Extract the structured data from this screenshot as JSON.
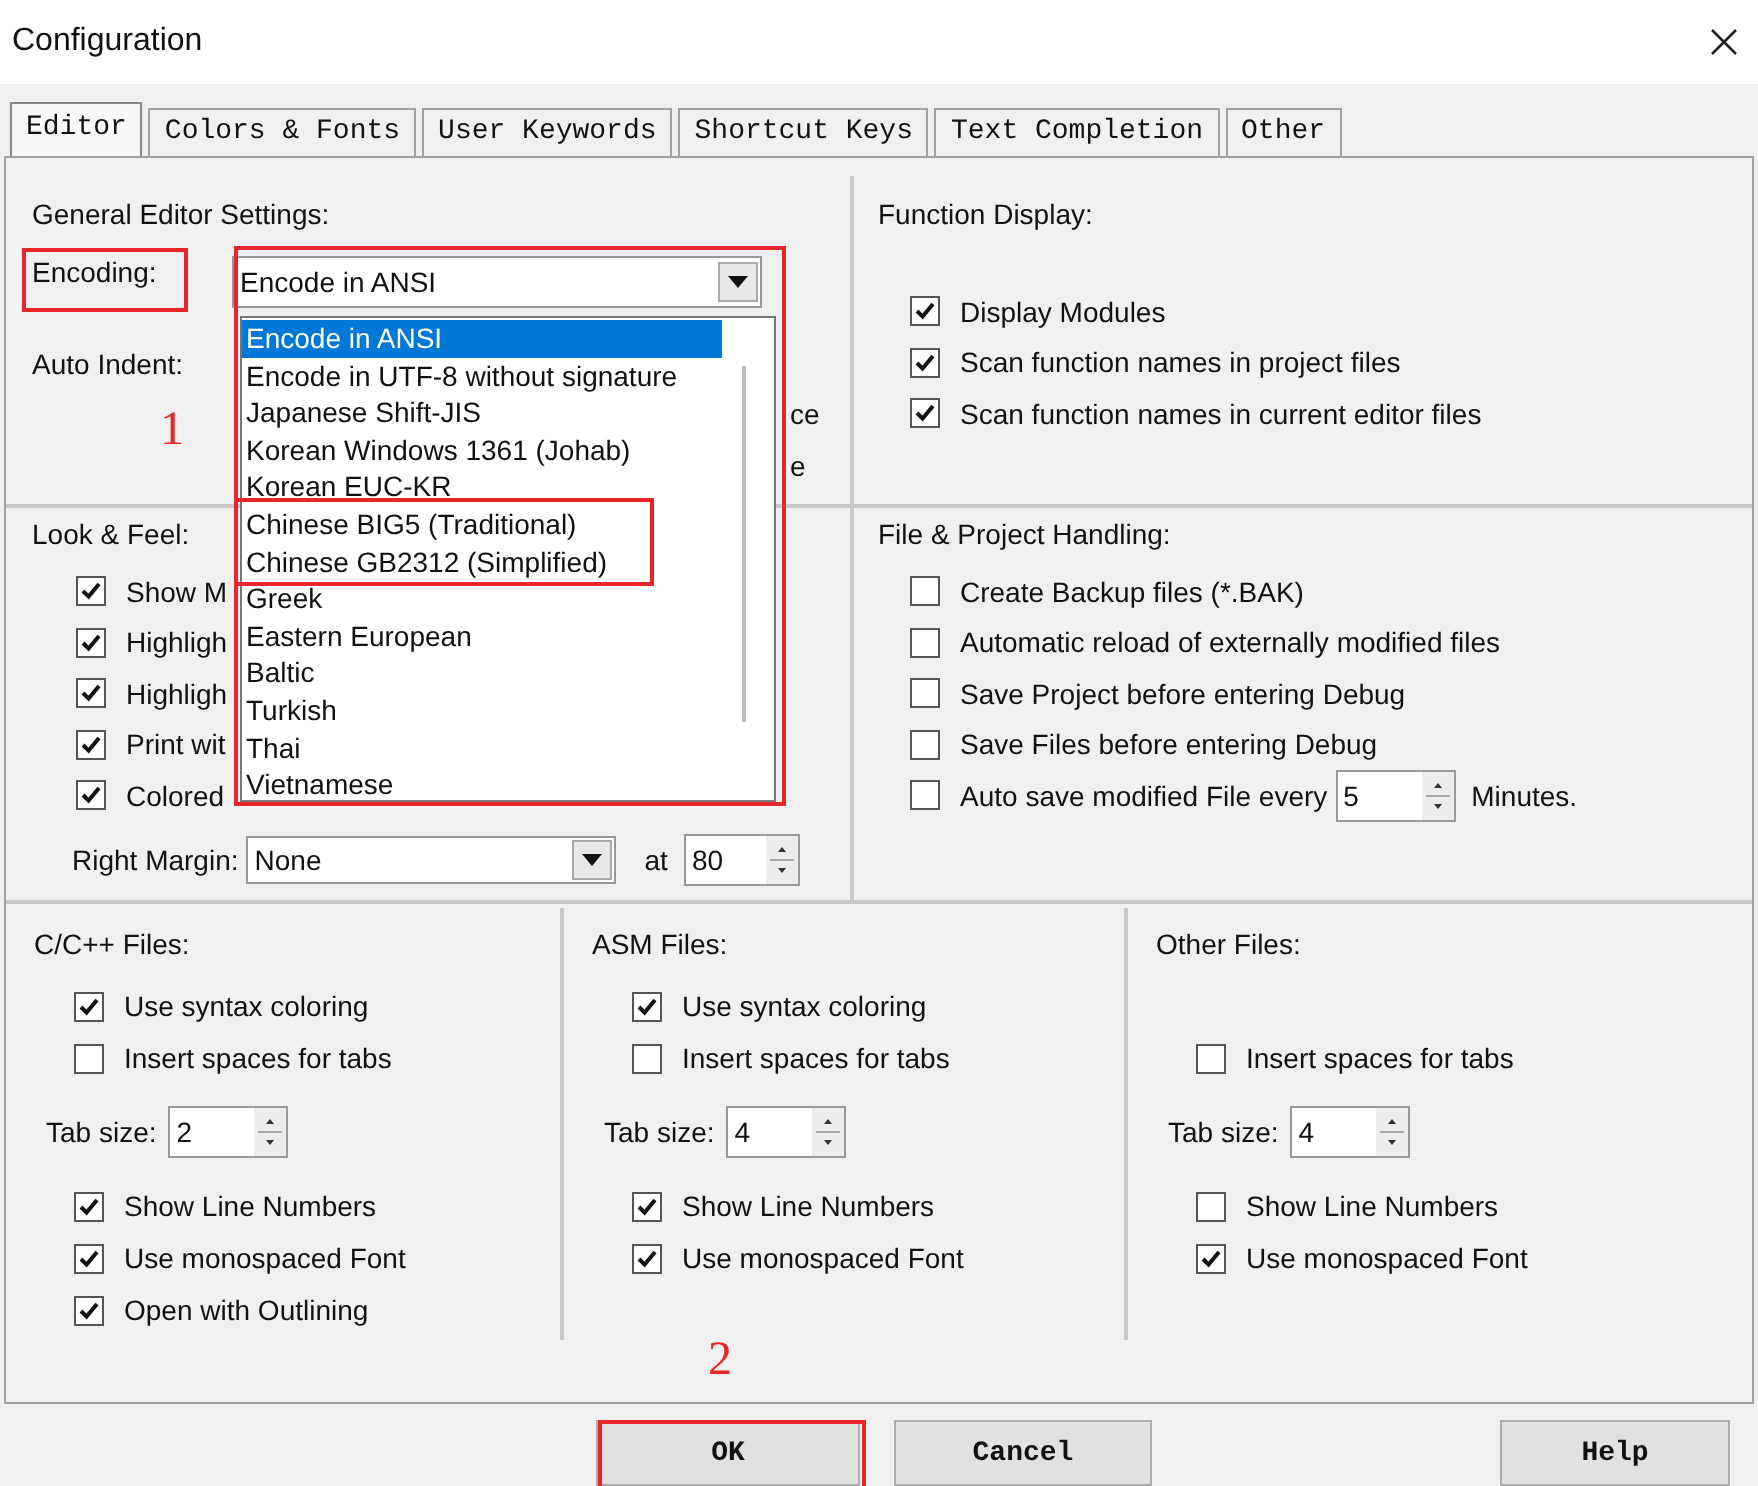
{
  "window": {
    "title": "Configuration"
  },
  "tabs": [
    {
      "label": "Editor",
      "selected": true
    },
    {
      "label": "Colors & Fonts",
      "selected": false
    },
    {
      "label": "User Keywords",
      "selected": false
    },
    {
      "label": "Shortcut Keys",
      "selected": false
    },
    {
      "label": "Text Completion",
      "selected": false
    },
    {
      "label": "Other",
      "selected": false
    }
  ],
  "general": {
    "title": "General Editor Settings:",
    "encoding_label": "Encoding:",
    "encoding_value": "Encode in ANSI",
    "auto_indent_label": "Auto Indent:",
    "hidden_fragments": [
      "ce",
      "e"
    ]
  },
  "encoding_dropdown": {
    "expanded": true,
    "options": [
      {
        "label": "Encode in ANSI",
        "selected": true
      },
      {
        "label": "Encode in UTF-8 without signature",
        "selected": false
      },
      {
        "label": "Japanese Shift-JIS",
        "selected": false
      },
      {
        "label": "Korean Windows 1361 (Johab)",
        "selected": false
      },
      {
        "label": "Korean EUC-KR",
        "selected": false
      },
      {
        "label": "Chinese BIG5 (Traditional)",
        "selected": false
      },
      {
        "label": "Chinese GB2312 (Simplified)",
        "selected": false
      },
      {
        "label": "Greek",
        "selected": false
      },
      {
        "label": "Eastern European",
        "selected": false
      },
      {
        "label": "Baltic",
        "selected": false
      },
      {
        "label": "Turkish",
        "selected": false
      },
      {
        "label": "Thai",
        "selected": false
      },
      {
        "label": "Vietnamese",
        "selected": false
      }
    ]
  },
  "look_feel": {
    "title": "Look & Feel:",
    "options": [
      {
        "label": "Show M",
        "checked": true
      },
      {
        "label": "Highligh",
        "checked": true
      },
      {
        "label": "Highligh",
        "checked": true
      },
      {
        "label": "Print wit",
        "checked": true
      },
      {
        "label": "Colored",
        "checked": true
      }
    ],
    "right_margin_label": "Right Margin:",
    "right_margin_value": "None",
    "at_label": "at",
    "at_value": "80"
  },
  "function_display": {
    "title": "Function Display:",
    "options": [
      {
        "label": "Display Modules",
        "checked": true
      },
      {
        "label": "Scan function names in project files",
        "checked": true
      },
      {
        "label": "Scan function names in current editor files",
        "checked": true
      }
    ]
  },
  "file_project": {
    "title": "File & Project Handling:",
    "options": [
      {
        "label": "Create Backup files (*.BAK)",
        "checked": false
      },
      {
        "label": "Automatic reload of externally modified files",
        "checked": false
      },
      {
        "label": "Save Project before entering Debug",
        "checked": false
      },
      {
        "label": "Save Files before entering Debug",
        "checked": false
      }
    ],
    "autosave": {
      "label": "Auto save modified File every",
      "checked": false,
      "value": "5",
      "unit": "Minutes."
    }
  },
  "file_types": [
    {
      "title": "C/C++ Files:",
      "items": [
        {
          "kind": "checkbox",
          "label": "Use syntax coloring",
          "checked": true
        },
        {
          "kind": "checkbox",
          "label": "Insert spaces for tabs",
          "checked": false
        },
        {
          "kind": "spin",
          "label": "Tab size:",
          "value": "2"
        },
        {
          "kind": "checkbox",
          "label": "Show Line Numbers",
          "checked": true
        },
        {
          "kind": "checkbox",
          "label": "Use monospaced Font",
          "checked": true
        },
        {
          "kind": "checkbox",
          "label": "Open with Outlining",
          "checked": true
        }
      ]
    },
    {
      "title": "ASM Files:",
      "items": [
        {
          "kind": "checkbox",
          "label": "Use syntax coloring",
          "checked": true
        },
        {
          "kind": "checkbox",
          "label": "Insert spaces for tabs",
          "checked": false
        },
        {
          "kind": "spin",
          "label": "Tab size:",
          "value": "4"
        },
        {
          "kind": "checkbox",
          "label": "Show Line Numbers",
          "checked": true
        },
        {
          "kind": "checkbox",
          "label": "Use monospaced Font",
          "checked": true
        }
      ]
    },
    {
      "title": "Other Files:",
      "items": [
        {
          "kind": "checkbox",
          "label": "Insert spaces for tabs",
          "checked": false
        },
        {
          "kind": "spin",
          "label": "Tab size:",
          "value": "4"
        },
        {
          "kind": "checkbox",
          "label": "Show Line Numbers",
          "checked": false
        },
        {
          "kind": "checkbox",
          "label": "Use monospaced Font",
          "checked": true
        }
      ]
    }
  ],
  "buttons": [
    {
      "label": "OK"
    },
    {
      "label": "Cancel"
    },
    {
      "label": "Help"
    }
  ],
  "annotations": [
    {
      "kind": "box"
    },
    {
      "kind": "box"
    },
    {
      "kind": "box"
    },
    {
      "kind": "box"
    },
    {
      "kind": "number",
      "text": "1"
    },
    {
      "kind": "number",
      "text": "2"
    }
  ]
}
